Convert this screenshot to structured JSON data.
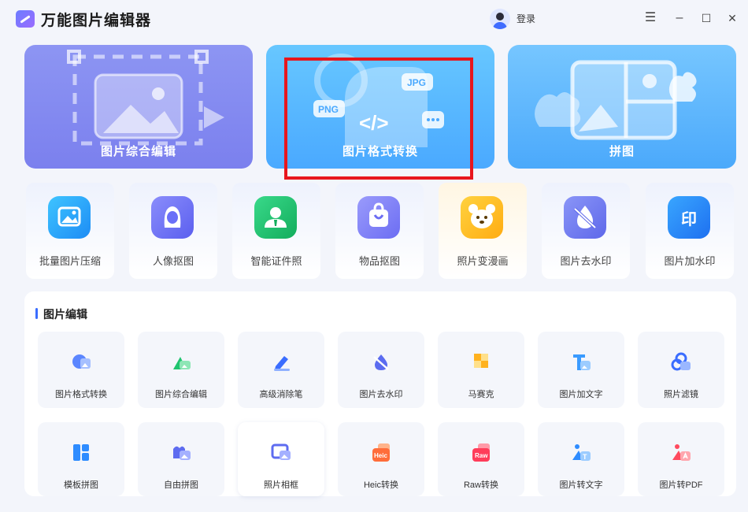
{
  "app": {
    "title": "万能图片编辑器",
    "login": "登录"
  },
  "window_controls": {
    "menu": "☰",
    "minimize": "–",
    "maximize": "☐",
    "close": "✕"
  },
  "hero_cards": [
    {
      "label": "图片综合编辑",
      "icon": "image-edit-icon"
    },
    {
      "label": "图片格式转换",
      "icon": "format-convert-icon",
      "badges": [
        "PNG",
        "JPG",
        "</>",
        "..."
      ]
    },
    {
      "label": "拼图",
      "icon": "collage-icon"
    }
  ],
  "tools": [
    {
      "label": "批量图片压缩",
      "icon": "batch-compress-icon",
      "color": "#2ab2ff"
    },
    {
      "label": "人像抠图",
      "icon": "portrait-cutout-icon",
      "color": "#6a6ff8"
    },
    {
      "label": "智能证件照",
      "icon": "id-photo-icon",
      "color": "#1fc46f"
    },
    {
      "label": "物品抠图",
      "icon": "object-cutout-icon",
      "color": "#7e7ff8"
    },
    {
      "label": "照片变漫画",
      "icon": "cartoon-icon",
      "color": "#ffbf1f"
    },
    {
      "label": "图片去水印",
      "icon": "remove-watermark-icon",
      "color": "#6e7cf3"
    },
    {
      "label": "图片加水印",
      "icon": "add-watermark-icon",
      "color": "#2e8cff",
      "glyph": "印"
    }
  ],
  "section": {
    "title": "图片编辑",
    "row1": [
      {
        "label": "图片格式转换",
        "icon": "format-convert-icon"
      },
      {
        "label": "图片综合编辑",
        "icon": "image-edit-icon"
      },
      {
        "label": "高级消除笔",
        "icon": "eraser-pen-icon"
      },
      {
        "label": "图片去水印",
        "icon": "remove-watermark-icon"
      },
      {
        "label": "马赛克",
        "icon": "mosaic-icon"
      },
      {
        "label": "图片加文字",
        "icon": "add-text-icon"
      },
      {
        "label": "照片滤镜",
        "icon": "filter-icon"
      }
    ],
    "row2": [
      {
        "label": "模板拼图",
        "icon": "template-collage-icon"
      },
      {
        "label": "自由拼图",
        "icon": "free-collage-icon"
      },
      {
        "label": "照片相框",
        "icon": "photo-frame-icon"
      },
      {
        "label": "Heic转换",
        "icon": "heic-convert-icon",
        "badge": "Heic"
      },
      {
        "label": "Raw转换",
        "icon": "raw-convert-icon",
        "badge": "Raw"
      },
      {
        "label": "图片转文字",
        "icon": "image-to-text-icon"
      },
      {
        "label": "图片转PDF",
        "icon": "image-to-pdf-icon"
      }
    ]
  }
}
